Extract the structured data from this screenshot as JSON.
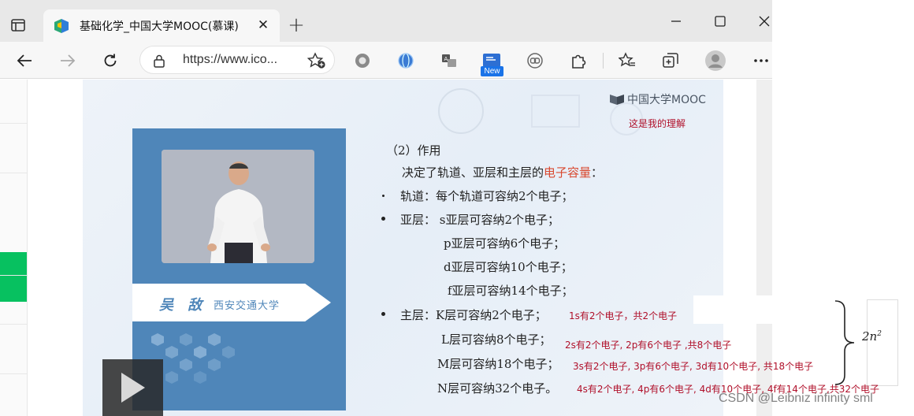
{
  "browser": {
    "tab": {
      "title": "基础化学_中国大学MOOC(慕课)",
      "favicon": "mooc-logo-icon"
    },
    "new_tab_label": "+",
    "address": {
      "url_text": "https://www.ico..."
    },
    "new_badge": "New",
    "window_controls": [
      "minimize-icon",
      "maximize-icon",
      "close-icon"
    ]
  },
  "slide": {
    "brand": "中国大学MOOC",
    "note": "这是我的理解",
    "speaker": {
      "name": "吴 敌",
      "school": "西安交通大学"
    },
    "lines": {
      "heading": "（2）作用",
      "intro_prefix": "决定了轨道、亚层和主层的",
      "intro_highlight": "电子容量",
      "intro_suffix": "：",
      "orbital": "轨道：每个轨道可容纳2个电子；",
      "subshell_s": "亚层：  s亚层可容纳2个电子；",
      "subshell_p": "p亚层可容纳6个电子；",
      "subshell_d": "d亚层可容纳10个电子；",
      "subshell_f": "f亚层可容纳14个电子；",
      "main_k": "主层：K层可容纳2个电子；",
      "main_l": "L层可容纳8个电子；",
      "main_m": "M层可容纳18个电子；",
      "main_n": "N层可容纳32个电子。"
    }
  },
  "annotations": {
    "k": "1s有2个电子，共2个电子",
    "l": "2s有2个电子, 2p有6个电子 ,共8个电子",
    "m": "3s有2个电子, 3p有6个电子, 3d有10个电子,  共18个电子",
    "n": "4s有2个电子, 4p有6个电子, 4d有10个电子, 4f有14个电子,共32个电子",
    "formula_base": "2n",
    "formula_exp": "2"
  },
  "watermark": "CSDN @Leibniz infinity sml",
  "colors": {
    "slide_panel": "#4f86b9",
    "annotation": "#b0102a",
    "highlight": "#d9482f",
    "green_tab": "#07c160"
  }
}
